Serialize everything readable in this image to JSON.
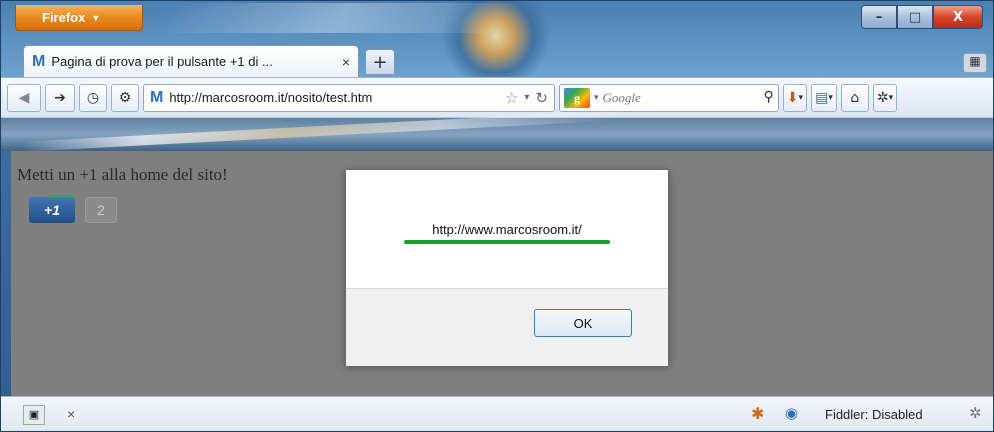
{
  "titlebar": {
    "menu_button_label": "Firefox",
    "menu_caret": "▼",
    "minimize": "–",
    "maximize": "□",
    "close": "X"
  },
  "tabs": {
    "active": {
      "favicon": "M",
      "title": "Pagina di prova per il pulsante +1 di ...",
      "close": "×"
    },
    "new_tab": "+"
  },
  "navbar": {
    "back_icon": "arrow-left-icon",
    "forward_icon": "arrow-right-icon",
    "url_favicon": "M",
    "url": "http://marcosroom.it/nosito/test.htm",
    "search_engine_letter": "g",
    "search_placeholder": "Google"
  },
  "content": {
    "heading": "Metti un +1 alla home del sito!",
    "plusone_label": "+1",
    "plusone_count": "2"
  },
  "dialog": {
    "message": "http://www.marcosroom.it/",
    "ok_label": "OK",
    "underline_color": "#1f9b2c"
  },
  "statusbar": {
    "close_label": "×",
    "fiddler_label": "Fiddler: Disabled"
  },
  "colors": {
    "firefox_button": "#e88a1f",
    "plusone_button": "#2f5f9a",
    "close_button": "#d5462c",
    "page_overlay": "#7f7f7f"
  }
}
